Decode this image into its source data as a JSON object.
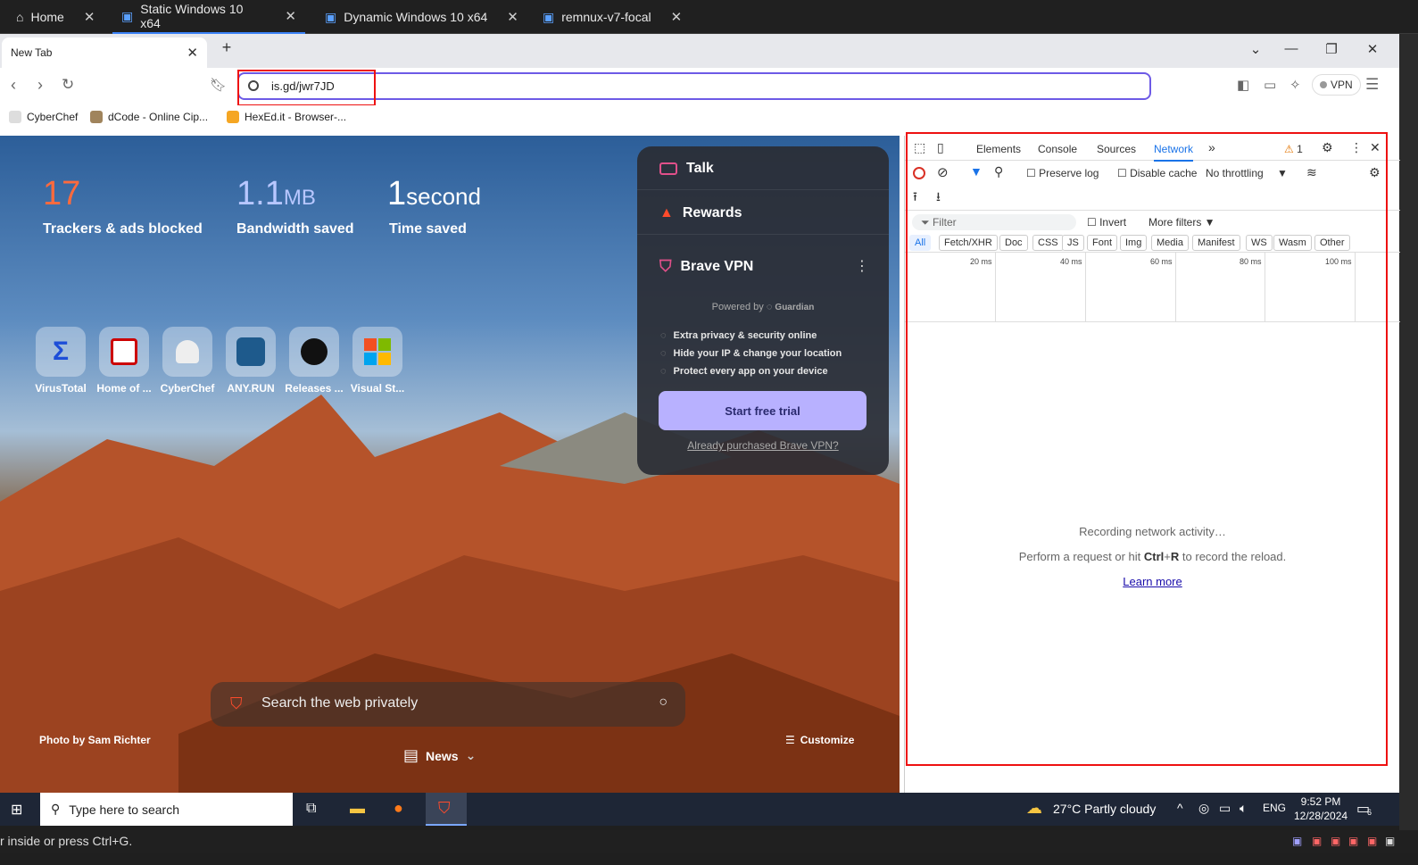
{
  "vm_tabs": [
    {
      "label": "Home",
      "icon": "home-icon"
    },
    {
      "label": "Static Windows 10 x64",
      "icon": "windows-icon",
      "active": true
    },
    {
      "label": "Dynamic Windows 10 x64",
      "icon": "windows-icon"
    },
    {
      "label": "remnux-v7-focal",
      "icon": "linux-icon"
    }
  ],
  "browser": {
    "tab_title": "New Tab",
    "url": "is.gd/jwr7JD",
    "vpn_label": "VPN",
    "bookmarks": [
      {
        "label": "CyberChef",
        "color": "#dddddd"
      },
      {
        "label": "dCode - Online Cip...",
        "color": "#a0845c"
      },
      {
        "label": "HexEd.it - Browser-...",
        "color": "#f5a623"
      }
    ]
  },
  "newtab": {
    "stats": [
      {
        "value": "17",
        "unit": "",
        "label": "Trackers & ads blocked",
        "color": "#ff6a3d"
      },
      {
        "value": "1.1",
        "unit": "MB",
        "label": "Bandwidth saved",
        "color": "#b8c7ff"
      },
      {
        "value": "1",
        "unit": "second",
        "label": "Time saved",
        "color": "#ffffff"
      }
    ],
    "tiles": [
      {
        "label": "VirusTotal",
        "icon": "virustotal-icon"
      },
      {
        "label": "Home of ...",
        "icon": "home-of-icon"
      },
      {
        "label": "CyberChef",
        "icon": "cyberchef-icon"
      },
      {
        "label": "ANY.RUN",
        "icon": "anyrun-icon"
      },
      {
        "label": "Releases ...",
        "icon": "github-icon"
      },
      {
        "label": "Visual St...",
        "icon": "microsoft-icon"
      }
    ],
    "panel": {
      "talk": "Talk",
      "rewards": "Rewards",
      "vpn_title": "Brave VPN",
      "powered_by": "Powered by",
      "guardian": "Guardian",
      "features": [
        "Extra privacy & security online",
        "Hide your IP & change your location",
        "Protect every app on your device"
      ],
      "trial_button": "Start free trial",
      "already_link": "Already purchased Brave VPN?"
    },
    "search_placeholder": "Search the web privately",
    "photo_credit": "Photo by Sam Richter",
    "news_label": "News",
    "customize_label": "Customize"
  },
  "devtools": {
    "tabs": [
      "Elements",
      "Console",
      "Sources",
      "Network"
    ],
    "active_tab": "Network",
    "warnings": "1",
    "preserve_log": "Preserve log",
    "disable_cache": "Disable cache",
    "throttling": "No throttling",
    "filter_placeholder": "Filter",
    "invert": "Invert",
    "more_filters": "More filters",
    "type_filters": [
      "All",
      "Fetch/XHR",
      "Doc",
      "CSS",
      "JS",
      "Font",
      "Img",
      "Media",
      "Manifest",
      "WS",
      "Wasm",
      "Other"
    ],
    "ticks": [
      "20 ms",
      "40 ms",
      "60 ms",
      "80 ms",
      "100 ms"
    ],
    "recording": "Recording network activity…",
    "hint_pre": "Perform a request or hit",
    "hint_key1": "Ctrl",
    "hint_plus": "+",
    "hint_key2": "R",
    "hint_post": "to record the reload.",
    "learn_more": "Learn more"
  },
  "taskbar": {
    "search_placeholder": "Type here to search",
    "weather": "27°C  Partly cloudy",
    "lang": "ENG",
    "time": "9:52 PM",
    "date": "12/28/2024",
    "notifications": "6"
  },
  "status_text": "r inside or press Ctrl+G."
}
